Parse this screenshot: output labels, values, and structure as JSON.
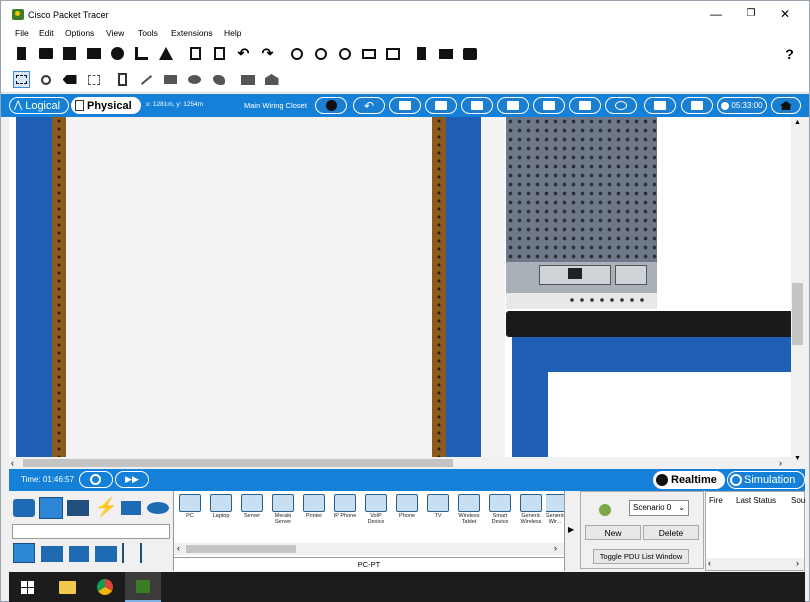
{
  "window": {
    "title": "Cisco Packet Tracer",
    "minimize": "—",
    "restore": "❐",
    "close": "✕"
  },
  "menu": {
    "items": [
      "File",
      "Edit",
      "Options",
      "View",
      "Tools",
      "Extensions",
      "Help"
    ]
  },
  "toolbar1": {
    "help_label": "?"
  },
  "physical_bar": {
    "logical_label": "Logical",
    "physical_label": "Physical",
    "coords": "x: 1281m, y: 1254m",
    "location": "Main Wiring Closet",
    "clock": "05:33:00"
  },
  "simbar": {
    "time": "Time: 01:46:57",
    "realtime_label": "Realtime",
    "simulation_label": "Simulation"
  },
  "device_panel": {
    "devices": [
      "PC",
      "Laptop",
      "Server",
      "Meraki Server",
      "Printer",
      "IP Phone",
      "VoIP Device",
      "Phone",
      "TV",
      "Wireless Tablet",
      "Smart Device",
      "Generic Wireless",
      "Generic Wir..."
    ],
    "selected_device": "PC-PT"
  },
  "scenario": {
    "selected": "Scenario 0",
    "new_label": "New",
    "delete_label": "Delete",
    "toggle_label": "Toggle PDU List Window"
  },
  "pdu_table": {
    "columns": [
      "Fire",
      "Last Status",
      "Sou"
    ]
  },
  "colors": {
    "accent_blue": "#1580d8",
    "rack_blue": "#1f5fb3",
    "rail_brown": "#8a5a1e"
  }
}
